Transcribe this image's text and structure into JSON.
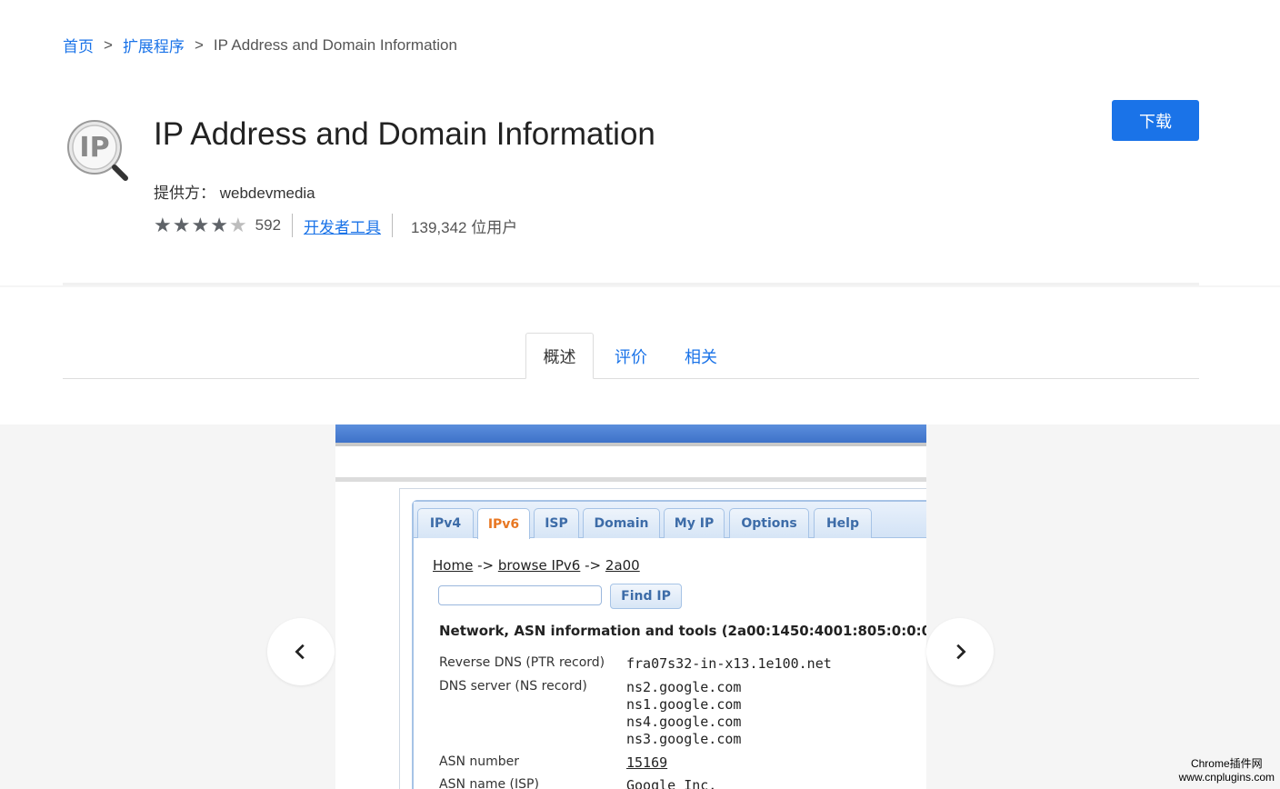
{
  "breadcrumb": {
    "home": "首页",
    "sep1": ">",
    "category": "扩展程序",
    "sep2": ">",
    "current": "IP Address and Domain Information"
  },
  "extension": {
    "icon": "ip-magnifier-icon",
    "title": "IP Address and Domain Information",
    "provider_label": "提供方：",
    "provider_name": "webdevmedia",
    "rating": 4,
    "rating_max": 5,
    "rating_count": "592",
    "category": "开发者工具",
    "users": "139,342 位用户"
  },
  "actions": {
    "download_label": "下载",
    "accent_color": "#1a73e8"
  },
  "tabs": [
    {
      "label": "概述",
      "active": true
    },
    {
      "label": "评价",
      "active": false
    },
    {
      "label": "相关",
      "active": false
    }
  ],
  "screenshot": {
    "tabs": [
      "IPv4",
      "IPv6",
      "ISP",
      "Domain",
      "My IP",
      "Options",
      "Help"
    ],
    "selected_tab": "IPv6",
    "crumbs": {
      "home": "Home",
      "arrow1": "->",
      "browse": "browse IPv6",
      "arrow2": "->",
      "prefix": "2a00"
    },
    "find_button": "Find IP",
    "heading": "Network, ASN information and tools (2a00:1450:4001:805:0:0:0:",
    "rows": [
      {
        "label": "Reverse DNS (PTR record)",
        "values": [
          "fra07s32-in-x13.1e100.net"
        ]
      },
      {
        "label": "DNS server (NS record)",
        "values": [
          "ns2.google.com",
          "ns1.google.com",
          "ns4.google.com",
          "ns3.google.com"
        ]
      },
      {
        "label": "ASN number",
        "values": [
          "15169"
        ]
      },
      {
        "label": "ASN name (ISP)",
        "values": [
          "Google Inc."
        ]
      }
    ]
  },
  "carousel": {
    "prev_icon": "chevron-left-icon",
    "next_icon": "chevron-right-icon"
  },
  "watermark": {
    "line1": "Chrome插件网",
    "line2": "www.cnplugins.com"
  }
}
